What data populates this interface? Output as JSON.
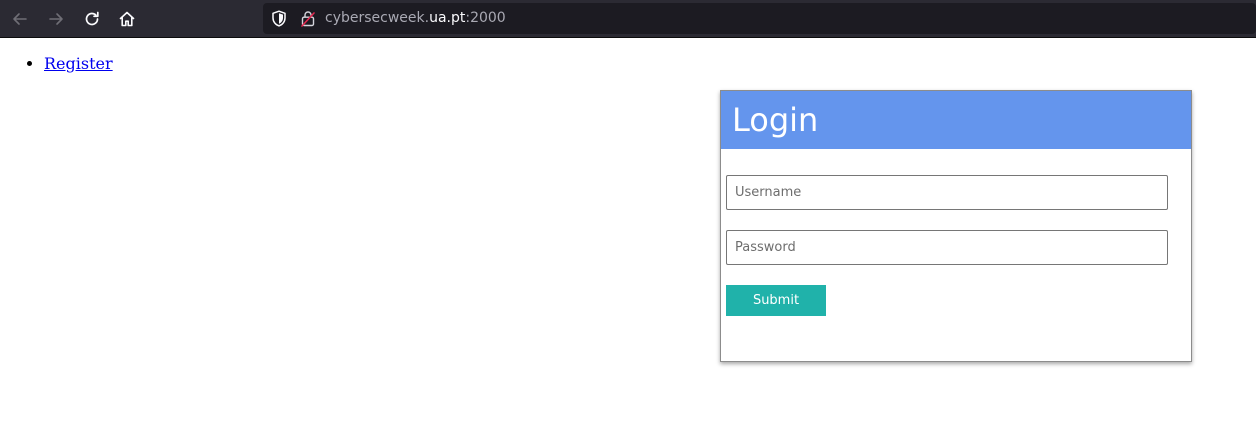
{
  "browser": {
    "url_prefix": "cybersecweek.",
    "url_domain": "ua.pt",
    "url_port": ":2000",
    "icons": {
      "back": "arrow-left-icon",
      "forward": "arrow-right-icon",
      "reload": "reload-icon",
      "home": "home-icon",
      "tracking": "shield-icon",
      "security": "insecure-lock-icon"
    }
  },
  "nav": {
    "items": [
      {
        "label": "Register"
      }
    ]
  },
  "login": {
    "title": "Login",
    "header_color": "#6495ed",
    "username_placeholder": "Username",
    "password_placeholder": "Password",
    "submit_label": "Submit",
    "submit_color": "#20b2aa"
  }
}
